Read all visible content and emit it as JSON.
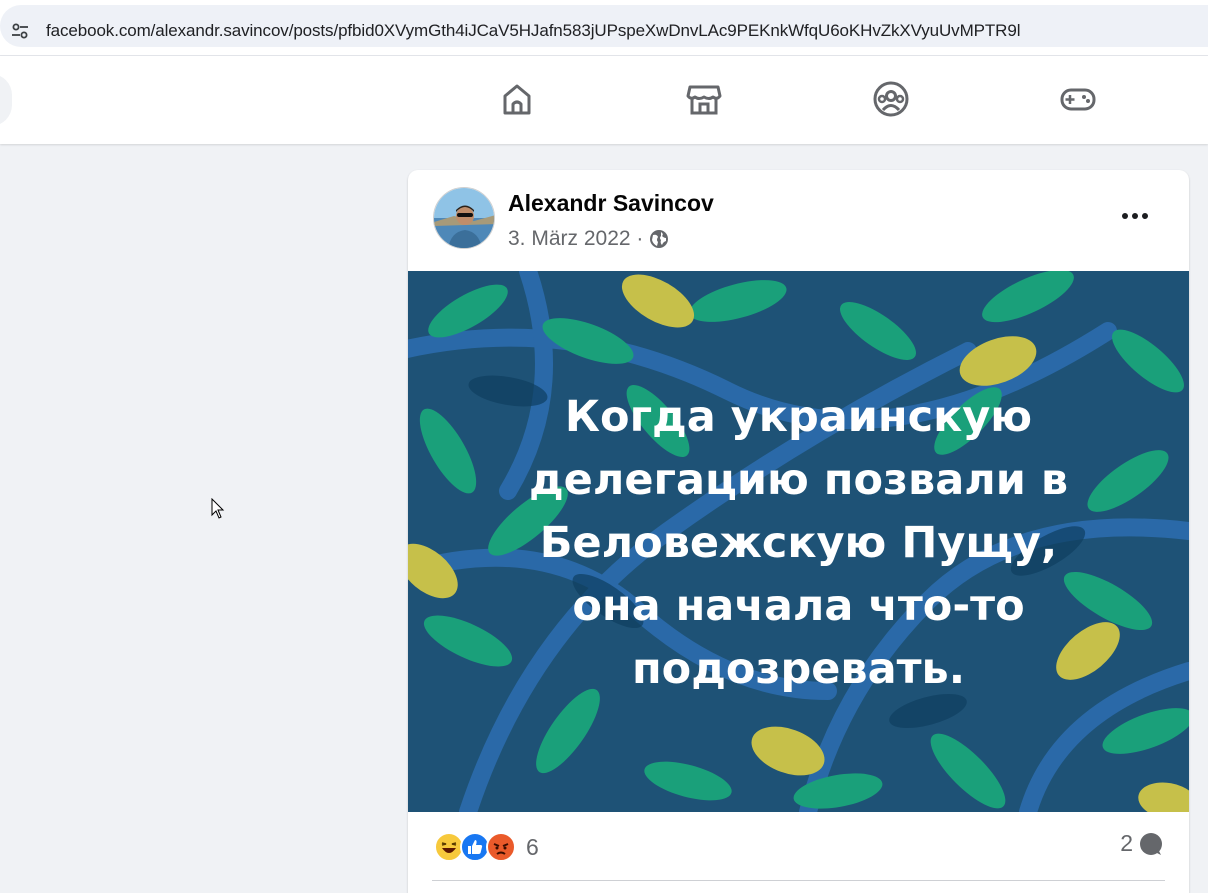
{
  "browser": {
    "url": "facebook.com/alexandr.savincov/posts/pfbid0XVymGth4iJCaV5HJafn583jUPspeXwDnvLAc9PEKnkWfqU6oKHvZkXVyuUvMPTR9l",
    "site_info_icon": "tune-icon"
  },
  "topnav": {
    "tabs": [
      {
        "name": "home",
        "icon": "home-icon"
      },
      {
        "name": "marketplace",
        "icon": "marketplace-icon"
      },
      {
        "name": "groups",
        "icon": "groups-icon"
      },
      {
        "name": "gaming",
        "icon": "gaming-icon"
      }
    ]
  },
  "post": {
    "author": "Alexandr Savincov",
    "date": "3. März 2022 ·",
    "privacy_icon": "globe-icon",
    "image_text": "Когда украинскую\nделегацию позвали в\nБеловежскую Пущу,\nона начала что-то\nподозревать.",
    "reactions": {
      "icons": [
        "haha",
        "like",
        "angry"
      ],
      "count": "6"
    },
    "comments_count": "2",
    "colors": {
      "background": "#1e5276",
      "leaf_green": "#1aa07a",
      "leaf_yellow": "#c6c04a",
      "branch": "#2a69a8"
    }
  }
}
